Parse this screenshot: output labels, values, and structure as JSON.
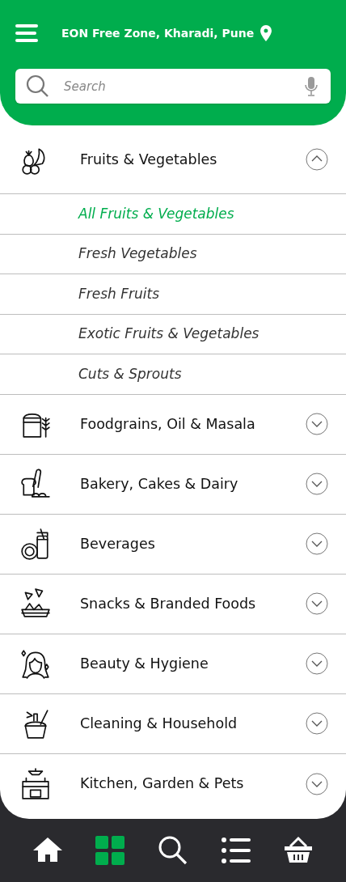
{
  "header": {
    "location": "EON Free Zone, Kharadi, Pune"
  },
  "search": {
    "placeholder": "Search"
  },
  "categories": [
    {
      "label": "Fruits & Vegetables",
      "expanded": true,
      "children": [
        {
          "label": "All Fruits & Vegetables",
          "selected": true
        },
        {
          "label": "Fresh Vegetables",
          "selected": false
        },
        {
          "label": "Fresh Fruits",
          "selected": false
        },
        {
          "label": "Exotic Fruits & Vegetables",
          "selected": false
        },
        {
          "label": "Cuts & Sprouts",
          "selected": false
        }
      ]
    },
    {
      "label": "Foodgrains, Oil & Masala",
      "expanded": false
    },
    {
      "label": "Bakery, Cakes & Dairy",
      "expanded": false
    },
    {
      "label": "Beverages",
      "expanded": false
    },
    {
      "label": "Snacks & Branded Foods",
      "expanded": false
    },
    {
      "label": "Beauty & Hygiene",
      "expanded": false
    },
    {
      "label": "Cleaning & Household",
      "expanded": false
    },
    {
      "label": "Kitchen, Garden & Pets",
      "expanded": false
    }
  ],
  "bottom_nav": [
    {
      "kind": "home",
      "selected": false
    },
    {
      "kind": "categories",
      "selected": true
    },
    {
      "kind": "search",
      "selected": false
    },
    {
      "kind": "list",
      "selected": false
    },
    {
      "kind": "basket",
      "selected": false
    }
  ]
}
